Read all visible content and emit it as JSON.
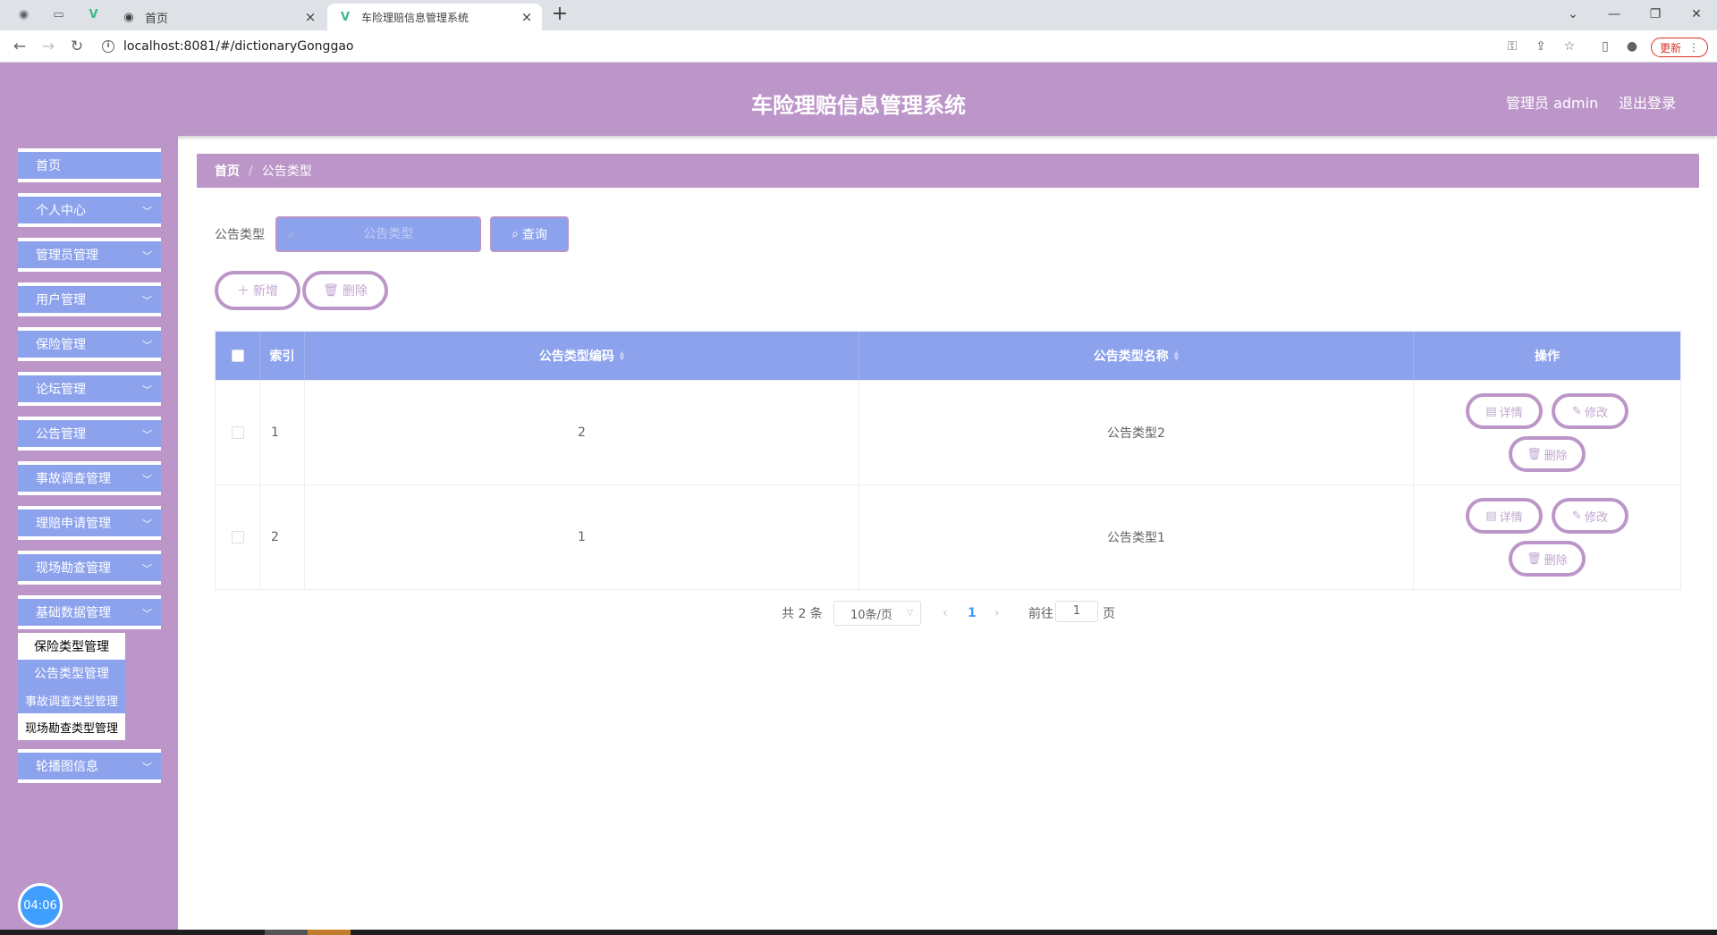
{
  "browser": {
    "tabs": [
      {
        "label": "首页",
        "active": false
      },
      {
        "label": "车险理赔信息管理系统",
        "active": true
      }
    ],
    "url": "localhost:8081/#/dictionaryGonggao",
    "update_label": "更新"
  },
  "header": {
    "title": "车险理赔信息管理系统",
    "user": "管理员 admin",
    "logout": "退出登录"
  },
  "sidebar": {
    "items": [
      {
        "label": "首页",
        "has_children": false
      },
      {
        "label": "个人中心",
        "has_children": true
      },
      {
        "label": "管理员管理",
        "has_children": true
      },
      {
        "label": "用户管理",
        "has_children": true
      },
      {
        "label": "保险管理",
        "has_children": true
      },
      {
        "label": "论坛管理",
        "has_children": true
      },
      {
        "label": "公告管理",
        "has_children": true
      },
      {
        "label": "事故调查管理",
        "has_children": true
      },
      {
        "label": "理赔申请管理",
        "has_children": true
      },
      {
        "label": "现场勘查管理",
        "has_children": true
      },
      {
        "label": "基础数据管理",
        "has_children": true
      },
      {
        "label": "轮播图信息",
        "has_children": true
      }
    ],
    "submenu": [
      {
        "label": "保险类型管理"
      },
      {
        "label": "公告类型管理"
      },
      {
        "label": "事故调查类型管理"
      },
      {
        "label": "现场勘查类型管理"
      }
    ],
    "clock": "04:06"
  },
  "breadcrumb": {
    "home": "首页",
    "sep": "/",
    "current": "公告类型"
  },
  "search": {
    "label": "公告类型",
    "placeholder": "公告类型",
    "button": "查询"
  },
  "actions": {
    "add": "新增",
    "delete": "删除"
  },
  "table": {
    "headers": {
      "index": "索引",
      "code": "公告类型编码",
      "name": "公告类型名称",
      "ops": "操作"
    },
    "rows": [
      {
        "index": "1",
        "code": "2",
        "name": "公告类型2"
      },
      {
        "index": "2",
        "code": "1",
        "name": "公告类型1"
      }
    ],
    "row_actions": {
      "detail": "详情",
      "edit": "修改",
      "delete": "删除"
    }
  },
  "pagination": {
    "total": "共 2 条",
    "page_size": "10条/页",
    "current_page": "1",
    "goto_prefix": "前往",
    "goto_value": "1",
    "goto_suffix": "页"
  },
  "colors": {
    "primary_purple": "#bd96c9",
    "accent_blue": "#8ca2ed"
  }
}
